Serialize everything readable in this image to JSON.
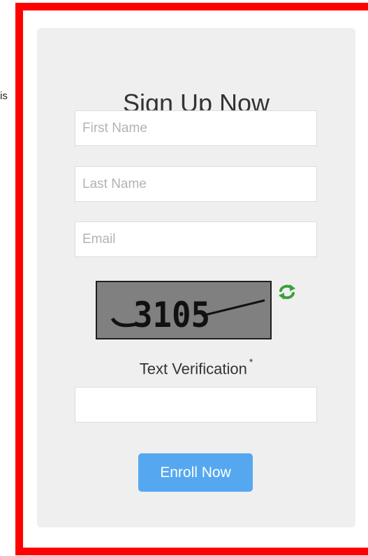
{
  "stray_text": "is",
  "form": {
    "title": "Sign Up Now",
    "fields": {
      "first_name_placeholder": "First Name",
      "last_name_placeholder": "Last Name",
      "email_placeholder": "Email",
      "verification_value": ""
    },
    "captcha": {
      "text": "3105",
      "refresh_icon": "refresh-icon"
    },
    "verification_label": "Text Verification",
    "required_marker": "*",
    "submit_label": "Enroll Now"
  },
  "colors": {
    "frame_border": "#ff0000",
    "card_background": "#efefef",
    "button_background": "#55a8f0",
    "captcha_background": "#808080",
    "refresh_icon_green": "#3aa13a"
  }
}
